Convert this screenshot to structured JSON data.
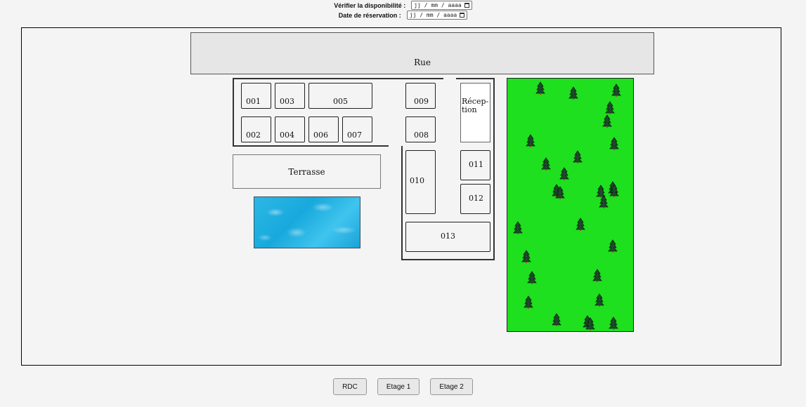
{
  "availability": {
    "label": "Vérifier la disponibilité :",
    "placeholder": "jj / mm / aaaa"
  },
  "reservation": {
    "label": "Date de réservation :",
    "placeholder": "jj / mm / aaaa"
  },
  "map": {
    "street": "Rue",
    "terrace": "Terrasse",
    "reception": [
      "Récep-",
      "tion"
    ],
    "rooms": [
      "001",
      "002",
      "003",
      "004",
      "005",
      "006",
      "007",
      "008",
      "009",
      "010",
      "011",
      "012",
      "013"
    ],
    "colors": {
      "garden": "#1ee01e",
      "pool": "#2cb8e6",
      "street": "#e6e6e6"
    },
    "garden_icon": "pine-tree-icon"
  },
  "floors": [
    "RDC",
    "Etage 1",
    "Etage 2"
  ]
}
